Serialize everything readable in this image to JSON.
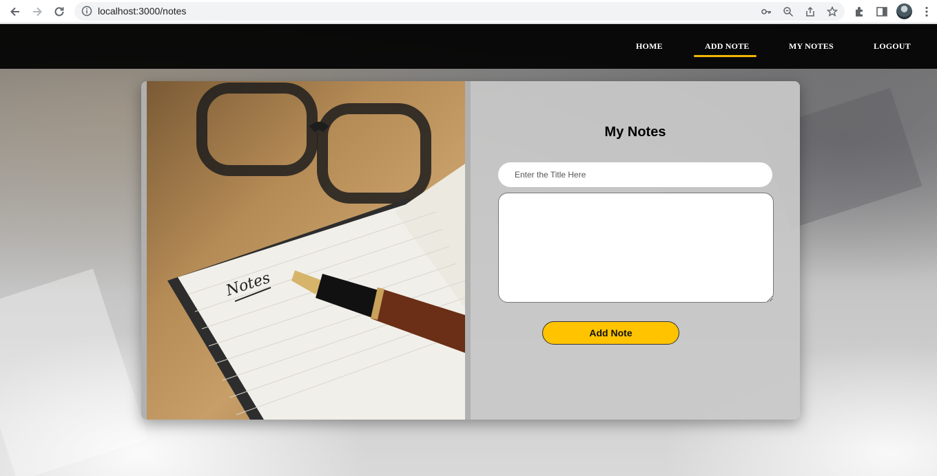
{
  "browser": {
    "url": "localhost:3000/notes"
  },
  "nav": {
    "items": [
      {
        "label": "HOME"
      },
      {
        "label": "ADD NOTE",
        "active": true
      },
      {
        "label": "MY NOTES"
      },
      {
        "label": "LOGOUT"
      }
    ],
    "accent_color": "#f2b705"
  },
  "form": {
    "title": "My Notes",
    "title_placeholder": "Enter the Title Here",
    "title_value": "",
    "body_value": "",
    "submit_label": "Add Note",
    "button_color": "#ffc300"
  },
  "illustration": {
    "handwritten_text": "Notes"
  }
}
